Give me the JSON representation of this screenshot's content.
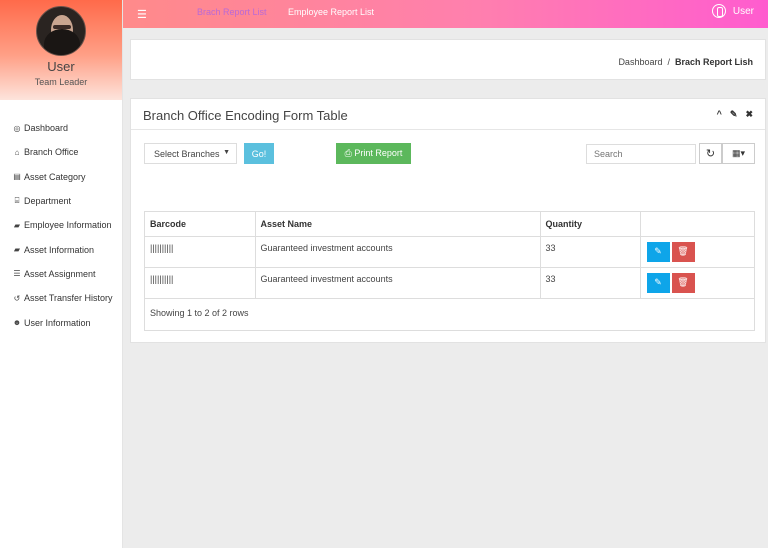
{
  "user": {
    "name": "User",
    "role": "Team Leader"
  },
  "sidebar": {
    "items": [
      {
        "label": "Dashboard",
        "icon": "dashboard-icon",
        "glyph": "◎"
      },
      {
        "label": "Branch Office",
        "icon": "home-icon",
        "glyph": "⌂"
      },
      {
        "label": "Asset Category",
        "icon": "file-icon",
        "glyph": "▤"
      },
      {
        "label": "Department",
        "icon": "bank-icon",
        "glyph": "⌸"
      },
      {
        "label": "Employee Information",
        "icon": "folder-icon",
        "glyph": "▰"
      },
      {
        "label": "Asset Information",
        "icon": "folder-icon",
        "glyph": "▰"
      },
      {
        "label": "Asset Assignment",
        "icon": "list-icon",
        "glyph": "☰"
      },
      {
        "label": "Asset Transfer History",
        "icon": "history-icon",
        "glyph": "↺"
      },
      {
        "label": "User Information",
        "icon": "users-icon",
        "glyph": "☻"
      }
    ]
  },
  "topbar": {
    "links": [
      "Brach Report List",
      "Employee Report List"
    ],
    "user_label": "User"
  },
  "breadcrumb": {
    "home": "Dashboard",
    "separator": "/",
    "current": "Brach Report Lish"
  },
  "panel": {
    "title": "Branch Office Encoding Form Table",
    "tools": [
      "^",
      "✎",
      "✖"
    ]
  },
  "controls": {
    "select_label": "Select Branches",
    "go_label": "Go!",
    "print_label": "⎙ Print Report",
    "search_placeholder": "Search",
    "refresh_glyph": "↻",
    "columns_glyph": "▦▾"
  },
  "table": {
    "headers": [
      "Barcode",
      "Asset Name",
      "Quantity",
      ""
    ],
    "rows": [
      {
        "barcode": "||||||||||",
        "asset_name": "Guaranteed investment accounts",
        "quantity": "33"
      },
      {
        "barcode": "||||||||||",
        "asset_name": "Guaranteed investment accounts",
        "quantity": "33"
      }
    ],
    "footer": "Showing 1 to 2 of 2 rows"
  },
  "colors": {
    "topbar_start": "#ff8a8a",
    "topbar_end": "#ff5ccf",
    "go": "#5bc0de",
    "print": "#5cb85c",
    "edit": "#0ea5e9",
    "delete": "#d9534f"
  }
}
